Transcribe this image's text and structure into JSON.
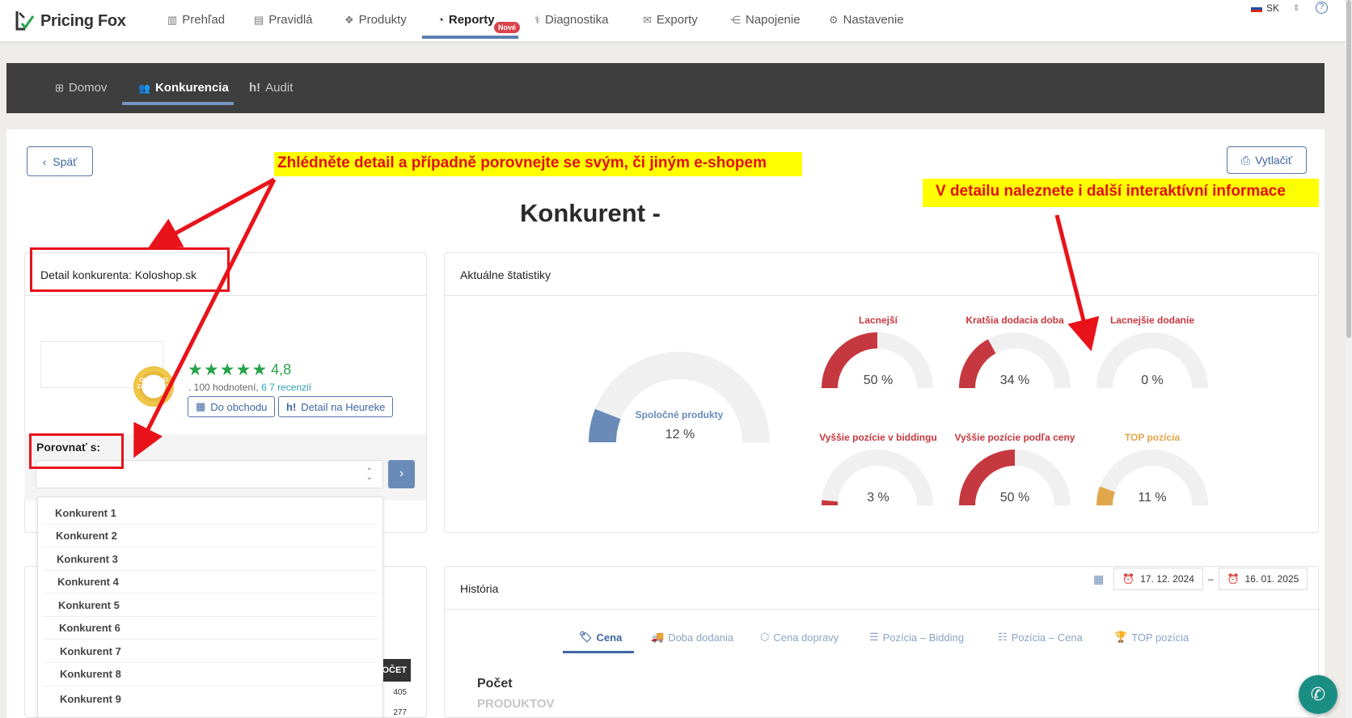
{
  "app": {
    "name": "Pricing Fox"
  },
  "topnav": {
    "items": [
      {
        "label": "Prehľad",
        "icon": "bar-chart-icon"
      },
      {
        "label": "Pravidlá",
        "icon": "list-icon"
      },
      {
        "label": "Produkty",
        "icon": "cubes-icon"
      },
      {
        "label": "Reporty",
        "icon": "pie-chart-icon",
        "badge": "Nové",
        "active": true
      },
      {
        "label": "Diagnostika",
        "icon": "stethoscope-icon"
      },
      {
        "label": "Exporty",
        "icon": "envelope-icon"
      },
      {
        "label": "Napojenie",
        "icon": "share-icon"
      },
      {
        "label": "Nastavenie",
        "icon": "gear-icon"
      }
    ],
    "lang": "SK",
    "help": "?"
  },
  "subnav": {
    "items": [
      {
        "label": "Domov",
        "icon": "grid-icon"
      },
      {
        "label": "Konkurencia",
        "icon": "users-icon",
        "active": true
      },
      {
        "label": "Audit",
        "icon": "heureka-icon",
        "prefix": "h!"
      }
    ]
  },
  "buttons": {
    "back": "Späť",
    "print": "Vytlačiť"
  },
  "page": {
    "title": "Konkurent -"
  },
  "detail": {
    "header": "Detail konkurenta: Koloshop.sk",
    "seal_text": "OVĚŘENO ZÁKAZNÍKY",
    "rating": "4,8",
    "stars": 5,
    "reviews_prefix": ". 100 hodnotení,",
    "reviews_link": "6  7 recenzií",
    "shop_button": "Do obchodu",
    "heureka_button": "Detail na Heureke",
    "compare_label": "Porovnať s:",
    "select_value": "",
    "go_button": "›"
  },
  "dropdown": {
    "options": [
      "Konkurent 1",
      "Konkurent 2",
      "Konkurent 3",
      "Konkurent 4",
      "Konkurent 5",
      "Konkurent 6",
      "Konkurent 7",
      "Konkurent 8",
      "Konkurent 9"
    ]
  },
  "mini_table": {
    "header": "OČET",
    "values": [
      "405",
      "277"
    ]
  },
  "stats": {
    "header": "Aktuálne štatistiky",
    "main_gauge": {
      "label": "Spoločné produkty",
      "value": "12 %",
      "fraction": 0.12,
      "color": "#6a8bb8"
    },
    "gauges": [
      {
        "label": "Lacnejší",
        "value": "50 %",
        "fraction": 0.5,
        "color": "#c6383f",
        "label_color": "#c6383f"
      },
      {
        "label": "Kratšia dodacia doba",
        "value": "34 %",
        "fraction": 0.34,
        "color": "#c6383f",
        "label_color": "#c6383f"
      },
      {
        "label": "Lacnejšie dodanie",
        "value": "0 %",
        "fraction": 0.0,
        "color": "#c6383f",
        "label_color": "#c6383f"
      },
      {
        "label": "Vyššie pozície v biddingu",
        "value": "3 %",
        "fraction": 0.03,
        "color": "#c6383f",
        "label_color": "#c6383f"
      },
      {
        "label": "Vyššie pozície podľa ceny",
        "value": "50 %",
        "fraction": 0.5,
        "color": "#c6383f",
        "label_color": "#c6383f"
      },
      {
        "label": "TOP pozícia",
        "value": "11 %",
        "fraction": 0.11,
        "color": "#e2a64a",
        "label_color": "#e2a64a"
      }
    ]
  },
  "history": {
    "header": "História",
    "date_from": "17. 12. 2024",
    "date_sep": "–",
    "date_to": "16. 01. 2025",
    "tabs": [
      {
        "label": "Cena",
        "icon": "tag-icon",
        "active": true
      },
      {
        "label": "Doba dodania",
        "icon": "truck-icon"
      },
      {
        "label": "Cena dopravy",
        "icon": "cube-icon"
      },
      {
        "label": "Pozícia – Bidding",
        "icon": "list-icon"
      },
      {
        "label": "Pozícia – Cena",
        "icon": "ordered-list-icon"
      },
      {
        "label": "TOP pozícia",
        "icon": "trophy-icon"
      }
    ],
    "pocet": "Počet",
    "produktov": "PRODUKTOV"
  },
  "annotations": {
    "note1": "Zhlédněte detail a případně porovnejte se svým, či jiným e-shopem",
    "note2": "V detailu naleznete i další interaktívní informace"
  }
}
